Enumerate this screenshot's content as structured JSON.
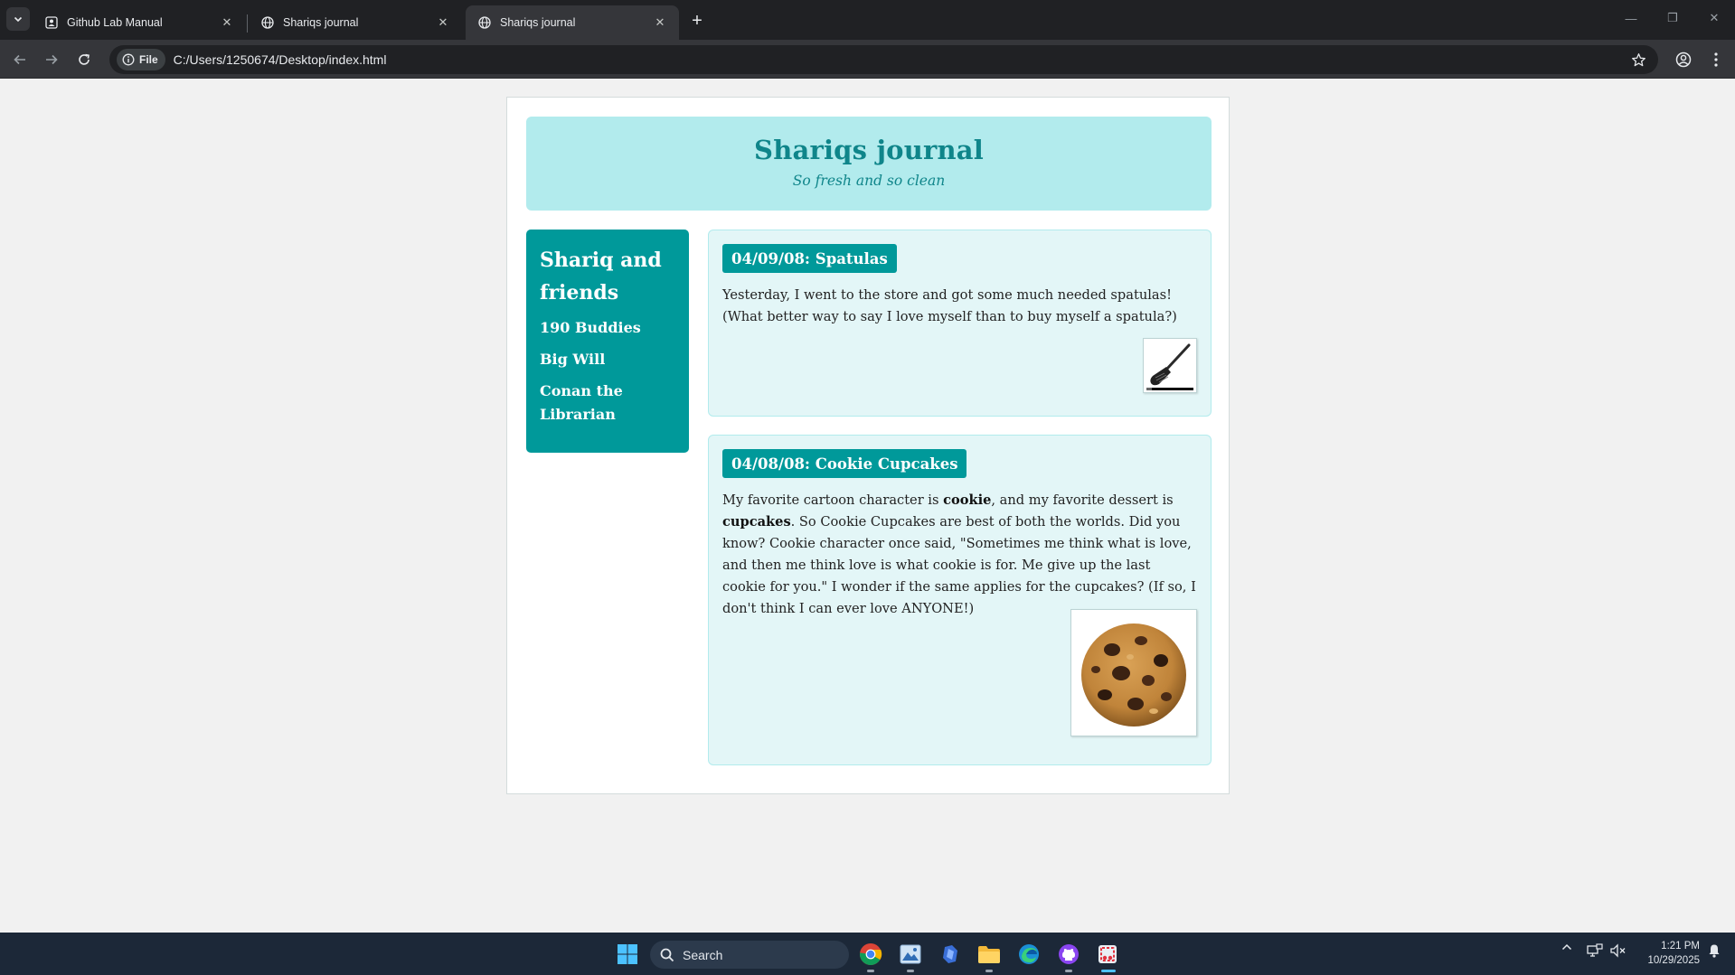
{
  "browser": {
    "tabs": [
      {
        "label": "Github Lab Manual",
        "active": false
      },
      {
        "label": "Shariqs journal",
        "active": false
      },
      {
        "label": "Shariqs journal",
        "active": true
      }
    ],
    "new_tab_label": "+",
    "address": {
      "chip_label": "File",
      "url": "C:/Users/1250674/Desktop/index.html"
    }
  },
  "page": {
    "title": "Shariqs journal",
    "subtitle": "So fresh and so clean",
    "sidebar": {
      "heading": "Shariq and friends",
      "friends": [
        "190 Buddies",
        "Big Will",
        "Conan the Librarian"
      ]
    },
    "posts": [
      {
        "title": "04/09/08: Spatulas",
        "body": "Yesterday, I went to the store and got some much needed spatulas! (What better way to say I love myself than to buy myself a spatula?)",
        "image": "spatula-image"
      },
      {
        "title": "04/08/08: Cookie Cupcakes",
        "body_parts": {
          "p1": "My favorite cartoon character is ",
          "b1": "cookie",
          "p2": ", and my favorite dessert is ",
          "b2": "cupcakes",
          "p3": ". So Cookie Cupcakes are best of both the worlds. Did you know? Cookie character once said, \"Sometimes me think what is love, and then me think love is what cookie is for. Me give up the last cookie for you.\" I wonder if the same applies for the cupcakes? (If so, I don't think I can ever love ANYONE!)"
        },
        "image": "cookie-image"
      }
    ]
  },
  "taskbar": {
    "search_label": "Search",
    "clock_time": "1:21 PM",
    "clock_date": "10/29/2025"
  },
  "colors": {
    "accent": "#00999a",
    "header_bg": "#b2ebed",
    "header_text": "#0f858a",
    "post_bg": "#e3f6f7"
  }
}
